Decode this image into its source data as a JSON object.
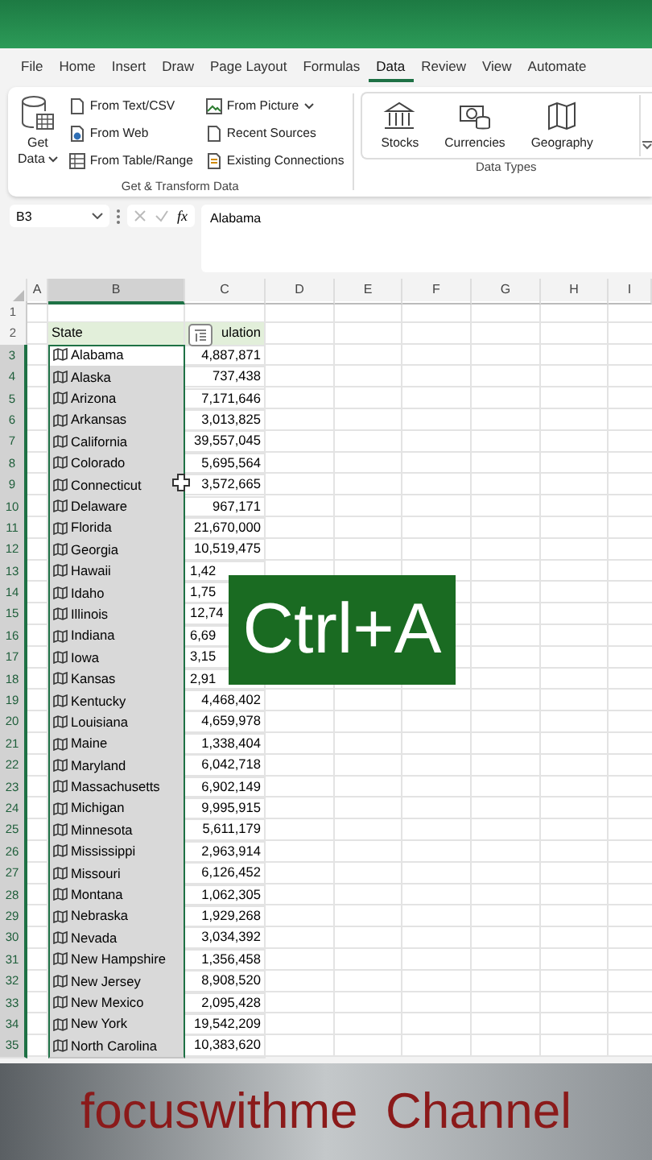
{
  "menu_tabs": [
    {
      "label": "File",
      "selected": false
    },
    {
      "label": "Home",
      "selected": false
    },
    {
      "label": "Insert",
      "selected": false
    },
    {
      "label": "Draw",
      "selected": false
    },
    {
      "label": "Page Layout",
      "selected": false
    },
    {
      "label": "Formulas",
      "selected": false
    },
    {
      "label": "Data",
      "selected": true
    },
    {
      "label": "Review",
      "selected": false
    },
    {
      "label": "View",
      "selected": false
    },
    {
      "label": "Automate",
      "selected": false
    }
  ],
  "ribbon": {
    "get_transform": {
      "get_data": [
        "Get",
        "Data"
      ],
      "commands": [
        {
          "label": "From Text/CSV",
          "dropdown": false
        },
        {
          "label": "From Web",
          "dropdown": false
        },
        {
          "label": "From Table/Range",
          "dropdown": false
        },
        {
          "label": "From Picture",
          "dropdown": true
        },
        {
          "label": "Recent Sources",
          "dropdown": false
        },
        {
          "label": "Existing Connections",
          "dropdown": false
        }
      ],
      "group_label": "Get & Transform Data"
    },
    "data_types": {
      "items": [
        "Stocks",
        "Currencies",
        "Geography"
      ],
      "group_label": "Data Types"
    }
  },
  "formula_bar": {
    "name_box": "B3",
    "function_label": "fx",
    "formula": "Alabama"
  },
  "columns": [
    {
      "label": "A",
      "selected": false
    },
    {
      "label": "B",
      "selected": true
    },
    {
      "label": "C",
      "selected": false
    },
    {
      "label": "D",
      "selected": false
    },
    {
      "label": "E",
      "selected": false
    },
    {
      "label": "F",
      "selected": false
    },
    {
      "label": "G",
      "selected": false
    },
    {
      "label": "H",
      "selected": false
    },
    {
      "label": "I",
      "selected": false
    }
  ],
  "rows": [
    {
      "number": "1",
      "selected": false,
      "kind": "empty"
    },
    {
      "number": "2",
      "selected": false,
      "kind": "header",
      "state": "State",
      "population": "ulation"
    },
    {
      "number": "3",
      "selected": true,
      "kind": "data",
      "state": "Alabama",
      "population": "4,887,871",
      "active": true,
      "covered": false
    },
    {
      "number": "4",
      "selected": true,
      "kind": "data",
      "state": "Alaska",
      "population": "737,438",
      "active": false,
      "covered": false
    },
    {
      "number": "5",
      "selected": true,
      "kind": "data",
      "state": "Arizona",
      "population": "7,171,646",
      "active": false,
      "covered": false
    },
    {
      "number": "6",
      "selected": true,
      "kind": "data",
      "state": "Arkansas",
      "population": "3,013,825",
      "active": false,
      "covered": false
    },
    {
      "number": "7",
      "selected": true,
      "kind": "data",
      "state": "California",
      "population": "39,557,045",
      "active": false,
      "covered": false
    },
    {
      "number": "8",
      "selected": true,
      "kind": "data",
      "state": "Colorado",
      "population": "5,695,564",
      "active": false,
      "covered": false
    },
    {
      "number": "9",
      "selected": true,
      "kind": "data",
      "state": "Connecticut",
      "population": "3,572,665",
      "active": false,
      "covered": false
    },
    {
      "number": "10",
      "selected": true,
      "kind": "data",
      "state": "Delaware",
      "population": "967,171",
      "active": false,
      "covered": false
    },
    {
      "number": "11",
      "selected": true,
      "kind": "data",
      "state": "Florida",
      "population": "21,670,000",
      "active": false,
      "covered": false
    },
    {
      "number": "12",
      "selected": true,
      "kind": "data",
      "state": "Georgia",
      "population": "10,519,475",
      "active": false,
      "covered": false
    },
    {
      "number": "13",
      "selected": true,
      "kind": "data",
      "state": "Hawaii",
      "population": "1,42",
      "active": false,
      "covered": true
    },
    {
      "number": "14",
      "selected": true,
      "kind": "data",
      "state": "Idaho",
      "population": "1,75",
      "active": false,
      "covered": true
    },
    {
      "number": "15",
      "selected": true,
      "kind": "data",
      "state": "Illinois",
      "population": "12,74",
      "active": false,
      "covered": true
    },
    {
      "number": "16",
      "selected": true,
      "kind": "data",
      "state": "Indiana",
      "population": "6,69",
      "active": false,
      "covered": true
    },
    {
      "number": "17",
      "selected": true,
      "kind": "data",
      "state": "Iowa",
      "population": "3,15",
      "active": false,
      "covered": true
    },
    {
      "number": "18",
      "selected": true,
      "kind": "data",
      "state": "Kansas",
      "population": "2,91",
      "active": false,
      "covered": true
    },
    {
      "number": "19",
      "selected": true,
      "kind": "data",
      "state": "Kentucky",
      "population": "4,468,402",
      "active": false,
      "covered": false
    },
    {
      "number": "20",
      "selected": true,
      "kind": "data",
      "state": "Louisiana",
      "population": "4,659,978",
      "active": false,
      "covered": false
    },
    {
      "number": "21",
      "selected": true,
      "kind": "data",
      "state": "Maine",
      "population": "1,338,404",
      "active": false,
      "covered": false
    },
    {
      "number": "22",
      "selected": true,
      "kind": "data",
      "state": "Maryland",
      "population": "6,042,718",
      "active": false,
      "covered": false
    },
    {
      "number": "23",
      "selected": true,
      "kind": "data",
      "state": "Massachusetts",
      "population": "6,902,149",
      "active": false,
      "covered": false
    },
    {
      "number": "24",
      "selected": true,
      "kind": "data",
      "state": "Michigan",
      "population": "9,995,915",
      "active": false,
      "covered": false
    },
    {
      "number": "25",
      "selected": true,
      "kind": "data",
      "state": "Minnesota",
      "population": "5,611,179",
      "active": false,
      "covered": false
    },
    {
      "number": "26",
      "selected": true,
      "kind": "data",
      "state": "Mississippi",
      "population": "2,963,914",
      "active": false,
      "covered": false
    },
    {
      "number": "27",
      "selected": true,
      "kind": "data",
      "state": "Missouri",
      "population": "6,126,452",
      "active": false,
      "covered": false
    },
    {
      "number": "28",
      "selected": true,
      "kind": "data",
      "state": "Montana",
      "population": "1,062,305",
      "active": false,
      "covered": false
    },
    {
      "number": "29",
      "selected": true,
      "kind": "data",
      "state": "Nebraska",
      "population": "1,929,268",
      "active": false,
      "covered": false
    },
    {
      "number": "30",
      "selected": true,
      "kind": "data",
      "state": "Nevada",
      "population": "3,034,392",
      "active": false,
      "covered": false
    },
    {
      "number": "31",
      "selected": true,
      "kind": "data",
      "state": "New Hampshire",
      "population": "1,356,458",
      "active": false,
      "covered": false
    },
    {
      "number": "32",
      "selected": true,
      "kind": "data",
      "state": "New Jersey",
      "population": "8,908,520",
      "active": false,
      "covered": false
    },
    {
      "number": "33",
      "selected": true,
      "kind": "data",
      "state": "New Mexico",
      "population": "2,095,428",
      "active": false,
      "covered": false
    },
    {
      "number": "34",
      "selected": true,
      "kind": "data",
      "state": "New York",
      "population": "19,542,209",
      "active": false,
      "covered": false
    },
    {
      "number": "35",
      "selected": true,
      "kind": "data",
      "state": "North Carolina",
      "population": "10,383,620",
      "active": false,
      "covered": false
    }
  ],
  "overlay": "Ctrl+A",
  "caption": "focuswithme  Channel"
}
